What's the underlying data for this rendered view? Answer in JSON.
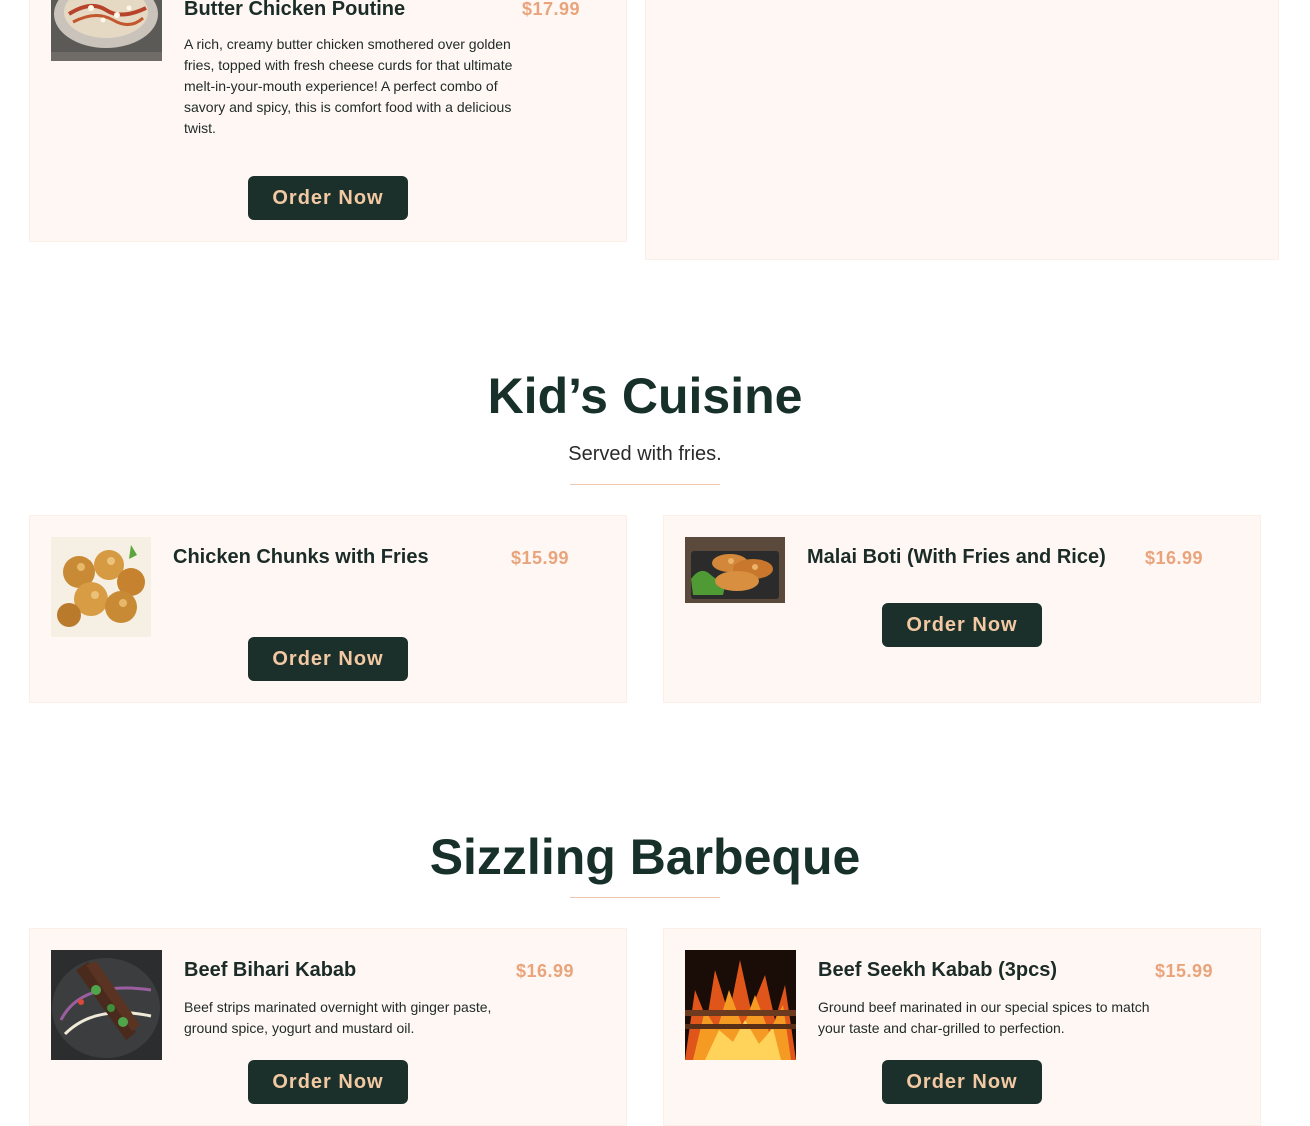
{
  "menu": {
    "order_label": "Order Now",
    "items": {
      "butter_chicken_poutine": {
        "name": "Butter Chicken Poutine",
        "price": "$17.99",
        "description": "A rich, creamy butter chicken smothered over golden fries, topped with fresh cheese curds for that ultimate melt-in-your-mouth experience! A perfect combo of savory and spicy, this is comfort food with a delicious twist."
      },
      "chicken_chunks": {
        "name": "Chicken Chunks with Fries",
        "price": "$15.99"
      },
      "malai_boti": {
        "name": "Malai Boti (With Fries and Rice)",
        "price": "$16.99"
      },
      "beef_bihari_kabab": {
        "name": "Beef Bihari Kabab",
        "price": "$16.99",
        "description": "Beef strips marinated overnight with ginger paste, ground spice, yogurt and mustard oil."
      },
      "beef_seekh_kabab": {
        "name": "Beef Seekh Kabab (3pcs)",
        "price": "$15.99",
        "description": "Ground beef marinated in our special spices to match your taste and char-grilled to perfection."
      }
    }
  },
  "sections": {
    "kids": {
      "title": "Kid’s Cuisine",
      "subtitle": "Served with fries."
    },
    "bbq": {
      "title": "Sizzling Barbeque"
    }
  },
  "colors": {
    "card_bg": "#fff7f3",
    "heading": "#17302a",
    "button_bg": "#1c302b",
    "button_text": "#f2c9a3",
    "price": "#e9a47c"
  }
}
